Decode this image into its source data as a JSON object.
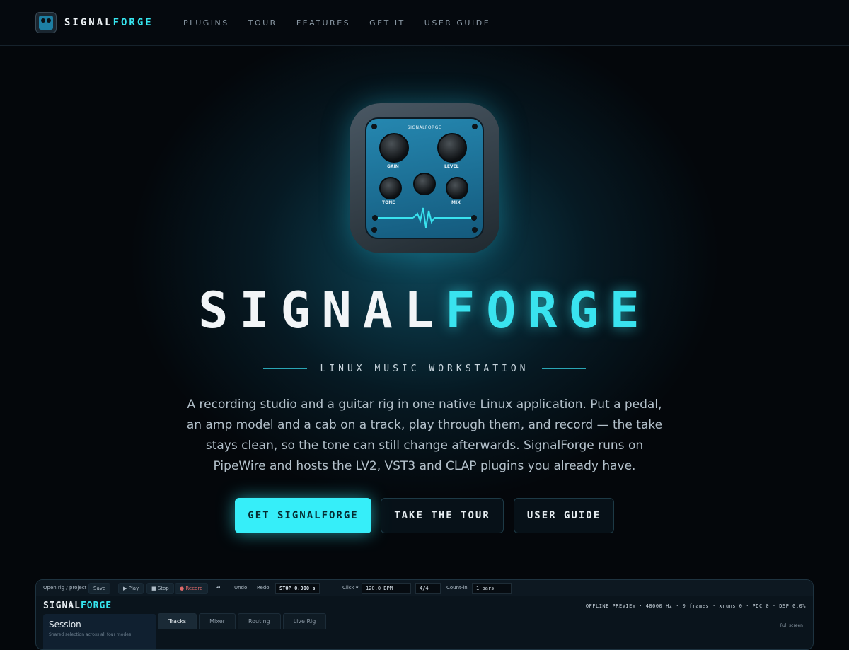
{
  "nav": {
    "brand_part1": "SIGNAL",
    "brand_part2": "FORGE",
    "links": [
      "PLUGINS",
      "TOUR",
      "FEATURES",
      "GET IT",
      "USER GUIDE"
    ]
  },
  "icon": {
    "title": "SIGNALFORGE",
    "knobs": [
      "GAIN",
      "LEVEL",
      "TONE",
      "MIX"
    ]
  },
  "hero": {
    "title_part1": "SIGNAL",
    "title_part2": "FORGE",
    "subtitle": "LINUX MUSIC WORKSTATION",
    "description": "A recording studio and a guitar rig in one native Linux application. Put a pedal, an amp model and a cab on a track, play through them, and record — the take stays clean, so the tone can still change afterwards. SignalForge runs on PipeWire and hosts the LV2, VST3 and CLAP plugins you already have."
  },
  "buttons": {
    "primary": "GET SIGNALFORGE",
    "tour": "TAKE THE TOUR",
    "guide": "USER GUIDE"
  },
  "preview": {
    "toolbar": {
      "open": "Open rig / project",
      "save": "Save",
      "play": "▶ Play",
      "stop": "■ Stop",
      "record": "● Record",
      "rewind": "⏮",
      "undo": "Undo",
      "redo": "Redo",
      "transport": "STOP 0.000 s",
      "click": "Click ▾",
      "bpm": "120.0 BPM",
      "meter": "4/4",
      "countin_label": "Count-in",
      "countin_value": "1 bars"
    },
    "brand_part1": "SIGNAL",
    "brand_part2": "FORGE",
    "status": "OFFLINE PREVIEW · 48000 Hz ·     0 frames · xruns     0 · PDC     0 · DSP   0.0%",
    "session_title": "Session",
    "session_sub": "Shared selection across all four modes",
    "tabs": [
      "Tracks",
      "Mixer",
      "Routing",
      "Live Rig"
    ],
    "fullscreen": "Full screen"
  },
  "colors": {
    "accent": "#36eef9",
    "background": "#04070b",
    "pedal_blue": "#2587b0"
  }
}
